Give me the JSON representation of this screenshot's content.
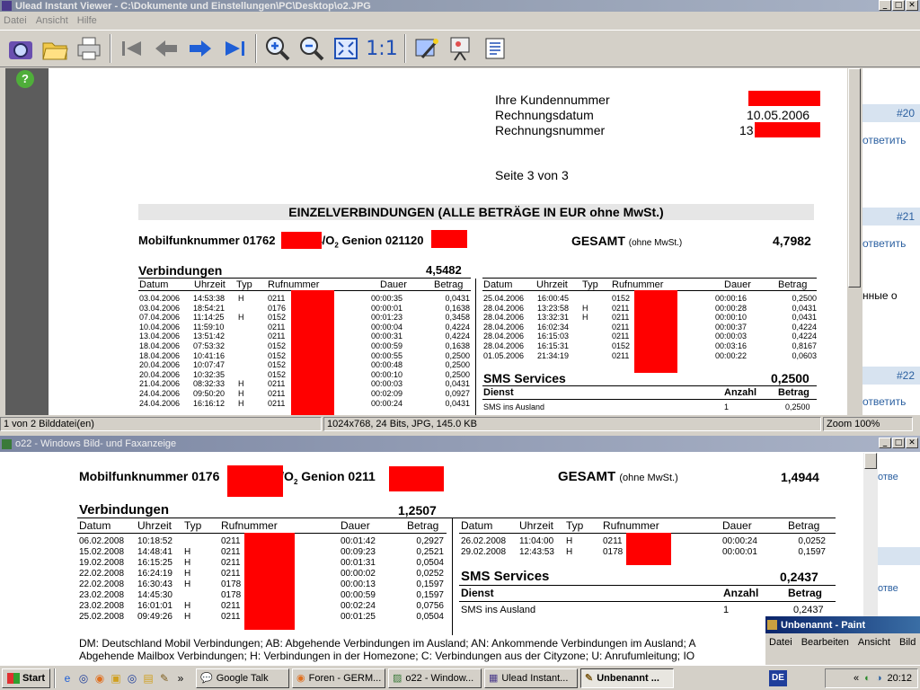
{
  "viewer": {
    "title": "Ulead Instant Viewer - C:\\Dokumente und Einstellungen\\PC\\Desktop\\o2.JPG",
    "menu": [
      "Datei",
      "Ansicht",
      "Hilfe"
    ],
    "zoom_label": "1:1",
    "status": {
      "count": "1 von 2 Bilddatei(en)",
      "info": "1024x768, 24 Bits, JPG, 145.0 KB",
      "zoom": "Zoom 100%"
    },
    "right_strip": {
      "bars": [
        "#20",
        "#21",
        "#22"
      ],
      "link": "ответить",
      "text": "нные о"
    },
    "page": {
      "customer_label": "Ihre Kundennummer",
      "date_label": "Rechnungsdatum",
      "date_value": "10.05.2006",
      "invoice_label": "Rechnungsnummer",
      "invoice_prefix": "13",
      "page_of": "Seite 3 von 3",
      "section_title": "EINZELVERBINDUNGEN (ALLE BETRÄGE IN EUR ohne MwSt.)",
      "mobile_prefix": "Mobilfunknummer 01762",
      "mobile_mid": "4/O",
      "mobile_sub": "2",
      "mobile_suffix": " Genion 021120",
      "total_label": "GESAMT",
      "total_note": "(ohne MwSt.)",
      "total_value": "4,7982",
      "connections_label": "Verbindungen",
      "connections_value": "4,5482",
      "headers": [
        "Datum",
        "Uhrzeit",
        "Typ",
        "Rufnummer",
        "Dauer",
        "Betrag"
      ],
      "rows_left": [
        [
          "03.04.2006",
          "14:53:38",
          "H",
          "0211",
          "00:00:35",
          "0,0431"
        ],
        [
          "03.04.2006",
          "18:54:21",
          "",
          "0176",
          "00:00:01",
          "0,1638"
        ],
        [
          "07.04.2006",
          "11:14:25",
          "H",
          "0152",
          "00:01:23",
          "0,3458"
        ],
        [
          "10.04.2006",
          "11:59:10",
          "",
          "0211",
          "00:00:04",
          "0,4224"
        ],
        [
          "13.04.2006",
          "13:51:42",
          "",
          "0211",
          "00:00:31",
          "0,4224"
        ],
        [
          "18.04.2006",
          "07:53:32",
          "",
          "0152",
          "00:00:59",
          "0,1638"
        ],
        [
          "18.04.2006",
          "10:41:16",
          "",
          "0152",
          "00:00:55",
          "0,2500"
        ],
        [
          "20.04.2006",
          "10:07:47",
          "",
          "0152",
          "00:00:48",
          "0,2500"
        ],
        [
          "20.04.2006",
          "10:32:35",
          "",
          "0152",
          "00:00:10",
          "0,2500"
        ],
        [
          "21.04.2006",
          "08:32:33",
          "H",
          "0211",
          "00:00:03",
          "0,0431"
        ],
        [
          "24.04.2006",
          "09:50:20",
          "H",
          "0211",
          "00:02:09",
          "0,0927"
        ],
        [
          "24.04.2006",
          "16:16:12",
          "H",
          "0211",
          "00:00:24",
          "0,0431"
        ]
      ],
      "rows_right": [
        [
          "25.04.2006",
          "16:00:45",
          "",
          "0152",
          "00:00:16",
          "0,2500"
        ],
        [
          "28.04.2006",
          "13:23:58",
          "H",
          "0211",
          "00:00:28",
          "0,0431"
        ],
        [
          "28.04.2006",
          "13:32:31",
          "H",
          "0211",
          "00:00:10",
          "0,0431"
        ],
        [
          "28.04.2006",
          "16:02:34",
          "",
          "0211",
          "00:00:37",
          "0,4224"
        ],
        [
          "28.04.2006",
          "16:15:03",
          "",
          "0211",
          "00:00:03",
          "0,4224"
        ],
        [
          "28.04.2006",
          "16:15:31",
          "",
          "0152",
          "00:03:16",
          "0,8167"
        ],
        [
          "01.05.2006",
          "21:34:19",
          "",
          "0211",
          "00:00:22",
          "0,0603"
        ]
      ],
      "sms_label": "SMS Services",
      "sms_value": "0,2500",
      "sms_headers": [
        "Dienst",
        "Anzahl",
        "Betrag"
      ],
      "sms_row": [
        "SMS ins Ausland",
        "1",
        "0,2500"
      ]
    }
  },
  "fax": {
    "title": "o22 - Windows Bild- und Faxanzeige",
    "right_strip": {
      "link": "отве"
    },
    "page": {
      "mobile_prefix": "Mobilfunknummer 0176",
      "mobile_mid": "4/O",
      "mobile_sub": "2",
      "mobile_suffix": " Genion 0211",
      "total_label": "GESAMT",
      "total_note": "(ohne MwSt.)",
      "total_value": "1,4944",
      "connections_label": "Verbindungen",
      "connections_value": "1,2507",
      "headers": [
        "Datum",
        "Uhrzeit",
        "Typ",
        "Rufnummer",
        "Dauer",
        "Betrag"
      ],
      "rows_left": [
        [
          "06.02.2008",
          "10:18:52",
          "",
          "0211",
          "00:01:42",
          "0,2927"
        ],
        [
          "15.02.2008",
          "14:48:41",
          "H",
          "0211",
          "00:09:23",
          "0,2521"
        ],
        [
          "19.02.2008",
          "16:15:25",
          "H",
          "0211",
          "00:01:31",
          "0,0504"
        ],
        [
          "22.02.2008",
          "16:24:19",
          "H",
          "0211",
          "00:00:02",
          "0,0252"
        ],
        [
          "22.02.2008",
          "16:30:43",
          "H",
          "0178",
          "00:00:13",
          "0,1597"
        ],
        [
          "23.02.2008",
          "14:45:30",
          "",
          "0178",
          "00:00:59",
          "0,1597"
        ],
        [
          "23.02.2008",
          "16:01:01",
          "H",
          "0211",
          "00:02:24",
          "0,0756"
        ],
        [
          "25.02.2008",
          "09:49:26",
          "H",
          "0211",
          "00:01:25",
          "0,0504"
        ]
      ],
      "rows_right": [
        [
          "26.02.2008",
          "11:04:00",
          "H",
          "0211",
          "00:00:24",
          "0,0252"
        ],
        [
          "29.02.2008",
          "12:43:53",
          "H",
          "0178",
          "00:00:01",
          "0,1597"
        ]
      ],
      "sms_label": "SMS Services",
      "sms_value": "0,2437",
      "sms_headers": [
        "Dienst",
        "Anzahl",
        "Betrag"
      ],
      "sms_row": [
        "SMS ins Ausland",
        "1",
        "0,2437"
      ],
      "legend_1": "DM: Deutschland Mobil Verbindungen; AB: Abgehende Verbindungen im Ausland; AN: Ankommende Verbindungen im Ausland; A",
      "legend_2": "Abgehende Mailbox Verbindungen; H: Verbindungen in der Homezone; C: Verbindungen aus der Cityzone; U: Anrufumleitung; IO"
    }
  },
  "paint": {
    "title": "Unbenannt - Paint",
    "menu": [
      "Datei",
      "Bearbeiten",
      "Ansicht",
      "Bild"
    ]
  },
  "taskbar": {
    "start": "Start",
    "more": "»",
    "tasks": [
      "Google Talk",
      "Foren - GERM...",
      "o22 - Window...",
      "Ulead Instant...",
      "Unbenannt ..."
    ],
    "lang": "DE",
    "tray_more": "«",
    "clock": "20:12"
  }
}
